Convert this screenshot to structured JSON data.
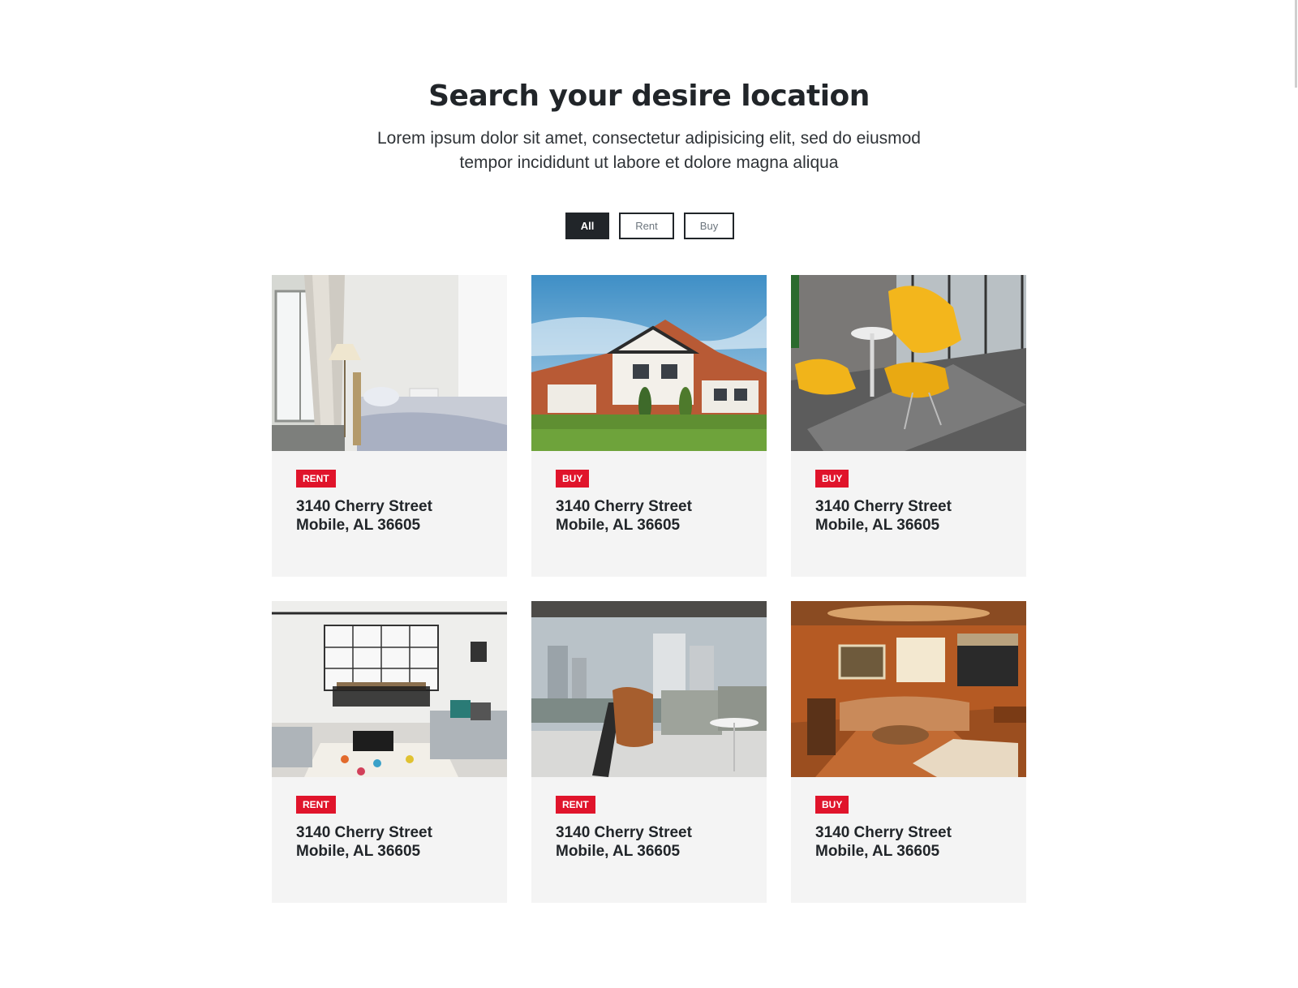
{
  "header": {
    "title": "Search your desire location",
    "subtitle_line1": "Lorem ipsum dolor sit amet, consectetur adipisicing elit, sed do eiusmod",
    "subtitle_line2": "tempor incididunt ut labore et dolore magna aliqua"
  },
  "filters": {
    "all_label": "All",
    "rent_label": "Rent",
    "buy_label": "Buy",
    "selected": "All"
  },
  "colors": {
    "accent": "#e0142b",
    "dark": "#212529",
    "card_bg": "#f4f4f4"
  },
  "listings": [
    {
      "badge": "RENT",
      "street": "3140 Cherry Street",
      "city": "Mobile, AL 36605",
      "image": "bedroom-photo"
    },
    {
      "badge": "BUY",
      "street": "3140 Cherry Street",
      "city": "Mobile, AL 36605",
      "image": "house-exterior-photo"
    },
    {
      "badge": "BUY",
      "street": "3140 Cherry Street",
      "city": "Mobile, AL 36605",
      "image": "yellow-chairs-photo"
    },
    {
      "badge": "RENT",
      "street": "3140 Cherry Street",
      "city": "Mobile, AL 36605",
      "image": "loft-living-room-photo"
    },
    {
      "badge": "RENT",
      "street": "3140 Cherry Street",
      "city": "Mobile, AL 36605",
      "image": "city-view-lounge-photo"
    },
    {
      "badge": "BUY",
      "street": "3140 Cherry Street",
      "city": "Mobile, AL 36605",
      "image": "billiard-lounge-photo"
    }
  ]
}
